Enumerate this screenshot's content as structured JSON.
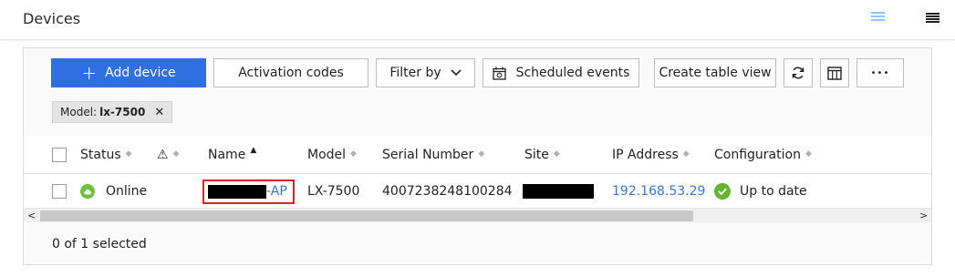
{
  "header": {
    "title": "Devices",
    "view_list_icon": "list-view-icon",
    "view_dense_icon": "compact-view-icon",
    "accent": "#8fc7ee"
  },
  "toolbar": {
    "add_device": "Add device",
    "activation_codes": "Activation codes",
    "filter_by": "Filter by",
    "scheduled_events": "Scheduled events",
    "create_table_view": "Create table view",
    "more": "•••",
    "primary_color": "#2f6fe0"
  },
  "filter_chip": {
    "prefix": "Model:",
    "value": "lx-7500",
    "close": "✕"
  },
  "table": {
    "columns": {
      "status": "Status",
      "alert": "⚠",
      "name": "Name",
      "model": "Model",
      "serial": "Serial Number",
      "site": "Site",
      "ip": "IP Address",
      "configuration": "Configuration"
    },
    "rows": [
      {
        "status": "Online",
        "name_suffix": "-AP",
        "model": "LX-7500",
        "serial": "4007238248100284",
        "ip": "192.168.53.29",
        "configuration": "Up to date"
      }
    ]
  },
  "footer": {
    "selection": "0 of 1 selected"
  }
}
